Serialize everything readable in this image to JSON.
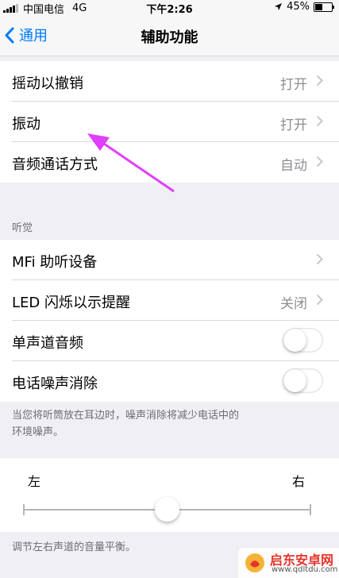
{
  "status_bar": {
    "carrier": "中国电信",
    "network": "4G",
    "time": "下午2:26",
    "battery": "45%",
    "battery_level": 0.45
  },
  "nav": {
    "back_label": "通用",
    "title": "辅助功能"
  },
  "group1": {
    "rows": [
      {
        "label": "摇动以撤销",
        "value": "打开"
      },
      {
        "label": "振动",
        "value": "打开"
      },
      {
        "label": "音频通话方式",
        "value": "自动"
      }
    ]
  },
  "hearing": {
    "header": "听觉",
    "rows": [
      {
        "label": "MFi 助听设备",
        "value": ""
      },
      {
        "label": "LED 闪烁以示提醒",
        "value": "关闭"
      },
      {
        "label": "单声道音频",
        "toggle": false
      },
      {
        "label": "电话噪声消除",
        "toggle": false
      }
    ],
    "footer_line1": "当您将听筒放在耳边时，噪声消除将减少电话中的",
    "footer_line2": "环境噪声。"
  },
  "balance": {
    "left_label": "左",
    "right_label": "右",
    "value": 0.5,
    "footer": "调节左右声道的音量平衡。"
  },
  "watermark": {
    "name": "启东安卓网",
    "url": "www.qdltdu.com"
  },
  "colors": {
    "accent": "#007aff",
    "annotation_arrow": "#e040fb",
    "background": "#efeff4"
  }
}
